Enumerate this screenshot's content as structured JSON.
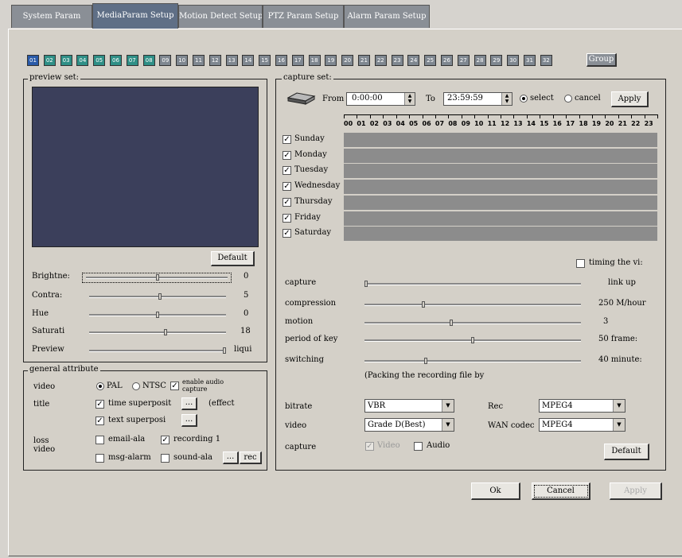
{
  "tabs": [
    {
      "label": "System Param",
      "active": false
    },
    {
      "label": "MediaParam Setup",
      "active": true
    },
    {
      "label": "Motion Detect Setup",
      "active": false
    },
    {
      "label": "PTZ Param Setup",
      "active": false
    },
    {
      "label": "Alarm Param Setup",
      "active": false
    }
  ],
  "channels": [
    "01",
    "02",
    "03",
    "04",
    "05",
    "06",
    "07",
    "08",
    "09",
    "10",
    "11",
    "12",
    "13",
    "14",
    "15",
    "16",
    "17",
    "18",
    "19",
    "20",
    "21",
    "22",
    "23",
    "24",
    "25",
    "26",
    "27",
    "28",
    "29",
    "30",
    "31",
    "32"
  ],
  "colors": {
    "channel_active": "#2a5aa8",
    "channel_teal": "#2f8f86",
    "channel_inactive": "#7f8790",
    "preview_bg": "#3b3f5b",
    "schedule_bar": "#8c8c8c"
  },
  "group_button": "Group",
  "preview": {
    "legend": "preview set:",
    "default_button": "Default",
    "sliders": [
      {
        "label": "Brightne:",
        "value": "0",
        "level": 0.5
      },
      {
        "label": "Contra:",
        "value": "5",
        "level": 0.52
      },
      {
        "label": "Hue",
        "value": "0",
        "level": 0.5
      },
      {
        "label": "Saturati",
        "value": "18",
        "level": 0.56
      },
      {
        "label": "Preview",
        "value": "liqui",
        "level": 1.0
      }
    ]
  },
  "general": {
    "legend": "general attribute",
    "video_label": "video",
    "pal": "PAL",
    "ntsc": "NTSC",
    "enable_audio": "enable audio capture",
    "title_label": "title",
    "time_superpose": "time superposit",
    "effect": "(effect",
    "text_superpose": "text superposi",
    "loss_video_label": "loss video",
    "email_alarm": "email-ala",
    "recording": "recording 1",
    "msg_alarm": "msg-alarm",
    "sound_alarm": "sound-ala",
    "rec_button": "rec",
    "more": "..."
  },
  "capture": {
    "legend": "capture set:",
    "from_label": "From",
    "from_value": "0:00:00",
    "to_label": "To",
    "to_value": "23:59:59",
    "select_label": "select",
    "cancel_label": "cancel",
    "apply_button": "Apply",
    "hours": [
      "00",
      "01",
      "02",
      "03",
      "04",
      "05",
      "06",
      "07",
      "08",
      "09",
      "10",
      "11",
      "12",
      "13",
      "14",
      "15",
      "16",
      "17",
      "18",
      "19",
      "20",
      "21",
      "22",
      "23"
    ],
    "days": [
      "Sunday",
      "Monday",
      "Tuesday",
      "Wednesday",
      "Thursday",
      "Friday",
      "Saturday"
    ],
    "timing_label": "timing the vi:",
    "params": [
      {
        "label": "capture",
        "value": "link up",
        "level": 0.0
      },
      {
        "label": "compression",
        "value": "250 M/hour",
        "level": 0.27
      },
      {
        "label": "motion",
        "value": "3",
        "level": 0.4
      },
      {
        "label": "period of key",
        "value": "50 frame:",
        "level": 0.5
      },
      {
        "label": "switching",
        "value": "40 minute:",
        "level": 0.28
      }
    ],
    "packing_note": "(Packing the recording file by",
    "bitrate_label": "bitrate",
    "bitrate_value": "VBR",
    "rec_label": "Rec",
    "rec_value": "MPEG4",
    "video_label": "video",
    "video_value": "Grade D(Best)",
    "wan_label": "WAN codec",
    "wan_value": "MPEG4",
    "capture_label": "capture",
    "video_cb": "Video",
    "audio_cb": "Audio",
    "default_button": "Default"
  },
  "footer": {
    "ok": "Ok",
    "cancel": "Cancel",
    "apply": "Apply"
  }
}
